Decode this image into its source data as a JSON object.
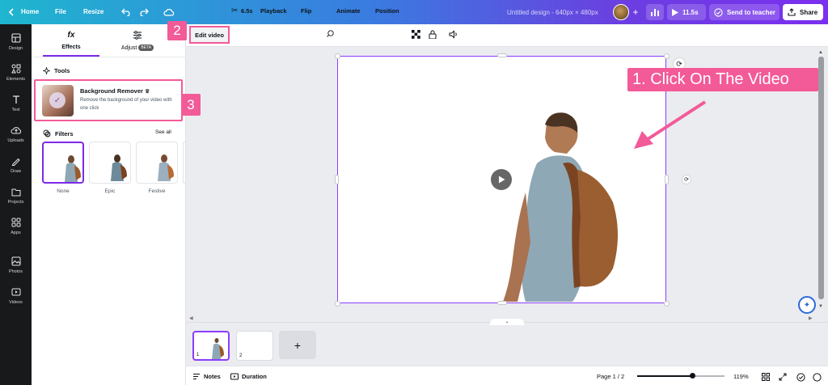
{
  "topbar": {
    "home": "Home",
    "file": "File",
    "resize": "Resize",
    "design_title": "Untitled design - 640px × 480px",
    "play_time": "11.5s",
    "send_to_teacher": "Send to teacher",
    "share": "Share",
    "icons": [
      "chevron-left-icon",
      "undo-icon",
      "redo-icon",
      "cloud-icon",
      "plus-icon",
      "stats-icon",
      "play-icon",
      "check-circle-icon",
      "upload-icon"
    ]
  },
  "rail": {
    "items": [
      {
        "label": "Design",
        "icon": "design-icon"
      },
      {
        "label": "Elements",
        "icon": "elements-icon"
      },
      {
        "label": "Text",
        "icon": "text-icon"
      },
      {
        "label": "Uploads",
        "icon": "uploads-icon"
      },
      {
        "label": "Draw",
        "icon": "draw-icon"
      },
      {
        "label": "Projects",
        "icon": "folder-icon"
      },
      {
        "label": "Apps",
        "icon": "apps-icon"
      },
      {
        "label": "Photos",
        "icon": "photos-icon"
      },
      {
        "label": "Videos",
        "icon": "videos-icon"
      }
    ]
  },
  "panel": {
    "tab_effects": "Effects",
    "tab_effects_icon": "fx",
    "tab_adjust": "Adjust",
    "beta": "BETA",
    "tools_title": "Tools",
    "bg_remover_title": "Background Remover",
    "bg_remover_desc": "Remove the background of your video with one click",
    "filters_title": "Filters",
    "see_all": "See all",
    "filters": [
      "None",
      "Epic",
      "Festive"
    ]
  },
  "toolbar": {
    "edit_video": "Edit video",
    "duration": "6.5s",
    "playback": "Playback",
    "flip": "Flip",
    "animate": "Animate",
    "position": "Position"
  },
  "annotations": {
    "step1": "1. Click On The Video",
    "step2": "2",
    "step3": "3",
    "accent": "#f25a98"
  },
  "timeline": {
    "pages": [
      "1",
      "2"
    ],
    "add": "+"
  },
  "bottombar": {
    "notes": "Notes",
    "duration": "Duration",
    "page_indicator": "Page 1 / 2",
    "zoom": "119%",
    "zoom_slider_fraction": 0.63
  },
  "colors": {
    "selection": "#8b3dff",
    "rail_bg": "#18191b",
    "annotation": "#f25a98"
  }
}
